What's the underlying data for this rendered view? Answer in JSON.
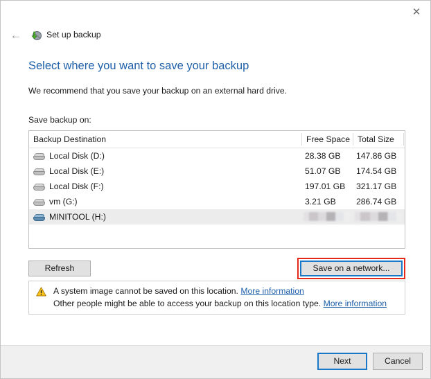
{
  "window": {
    "close_label": "✕",
    "back_label": "←",
    "title": "Set up backup",
    "app_icon": "backup-restore-icon"
  },
  "page": {
    "heading": "Select where you want to save your backup",
    "subtext": "We recommend that you save your backup on an external hard drive.",
    "list_label": "Save backup on:",
    "accent_color": "#1d5fa8",
    "highlight_color": "#e8271b",
    "focus_color": "#1a78c8"
  },
  "destination_list": {
    "columns": [
      "Backup Destination",
      "Free Space",
      "Total Size"
    ],
    "rows": [
      {
        "name": "Local Disk (D:)",
        "free": "28.38 GB",
        "total": "147.86 GB",
        "icon": "hard-disk-icon",
        "selected": false,
        "redacted": false
      },
      {
        "name": "Local Disk (E:)",
        "free": "51.07 GB",
        "total": "174.54 GB",
        "icon": "hard-disk-icon",
        "selected": false,
        "redacted": false
      },
      {
        "name": "Local Disk (F:)",
        "free": "197.01 GB",
        "total": "321.17 GB",
        "icon": "hard-disk-icon",
        "selected": false,
        "redacted": false
      },
      {
        "name": "vm (G:)",
        "free": "3.21 GB",
        "total": "286.74 GB",
        "icon": "hard-disk-icon",
        "selected": false,
        "redacted": false
      },
      {
        "name": "MINITOOL (H:)",
        "free": "",
        "total": "",
        "icon": "removable-drive-icon",
        "selected": true,
        "redacted": true
      }
    ]
  },
  "buttons": {
    "refresh": "Refresh",
    "save_on_network": "Save on a network...",
    "next": "Next",
    "cancel": "Cancel"
  },
  "warning": {
    "icon": "warning-triangle-icon",
    "line1_text": "A system image cannot be saved on this location.",
    "line1_link": "More information",
    "line2_text": "Other people might be able to access your backup on this location type.",
    "line2_link": "More information"
  }
}
